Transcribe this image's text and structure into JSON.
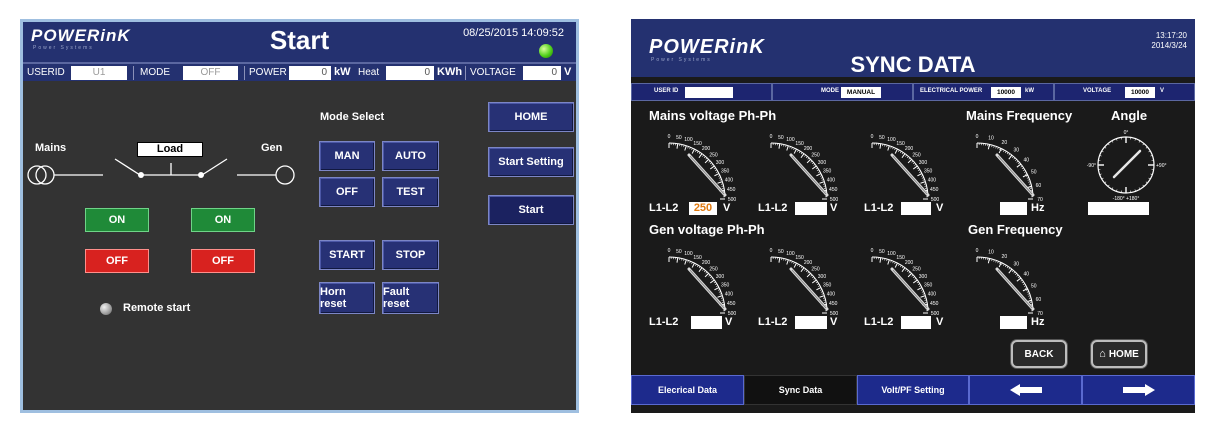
{
  "left": {
    "logo": "POWERinK",
    "logo_sub": "Power Systems",
    "title": "Start",
    "datetime": "08/25/2015 14:09:52",
    "status": {
      "userid_label": "USERID",
      "userid_value": "U1",
      "mode_label": "MODE",
      "mode_value": "OFF",
      "power_label": "POWER",
      "power_value": "0",
      "power_unit": "kW",
      "heat_label": "Heat",
      "heat_value": "0",
      "heat_unit": "KWh",
      "voltage_label": "VOLTAGE",
      "voltage_value": "0",
      "voltage_unit": "V"
    },
    "diagram": {
      "mains": "Mains",
      "load": "Load",
      "gen": "Gen"
    },
    "mains_on": "ON",
    "mains_off": "OFF",
    "gen_on": "ON",
    "gen_off": "OFF",
    "remote_start": "Remote start",
    "mode_select": "Mode Select",
    "btn_man": "MAN",
    "btn_auto": "AUTO",
    "btn_off": "OFF",
    "btn_test": "TEST",
    "btn_start": "START",
    "btn_stop": "STOP",
    "btn_horn_reset": "Horn reset",
    "btn_fault_reset": "Fault reset",
    "nav_home": "HOME",
    "nav_start_setting": "Start Setting",
    "nav_start": "Start",
    "led_color": "#4fcf1a"
  },
  "right": {
    "logo": "POWERinK",
    "logo_sub": "Power Systems",
    "title": "SYNC DATA",
    "time": "13:17:20",
    "date": "2014/3/24",
    "status": {
      "user_label": "USER ID",
      "user_value": "",
      "mode_label": "MODE",
      "mode_value": "MANUAL",
      "power_label": "ELECTRICAL POWER",
      "power_value": "10000",
      "power_unit": "kW",
      "voltage_label": "VOLTAGE",
      "voltage_value": "10000",
      "voltage_unit": "V"
    },
    "mains_voltage_title": "Mains voltage Ph-Ph",
    "mains_freq_title": "Mains Frequency",
    "angle_title": "Angle",
    "gen_voltage_title": "Gen voltage Ph-Ph",
    "gen_freq_title": "Gen Frequency",
    "voltage_scale": [
      "0",
      "50",
      "100",
      "150",
      "200",
      "250",
      "300",
      "350",
      "400",
      "450",
      "500"
    ],
    "freq_scale": [
      "0",
      "10",
      "20",
      "30",
      "40",
      "50",
      "60",
      "70"
    ],
    "angle_labels": {
      "top": "0°",
      "left": "-90°",
      "right": "+90°",
      "bottom": "-180° +180°"
    },
    "phase_label": "L1-L2",
    "volt_unit": "V",
    "hz_unit": "Hz",
    "mains_l1_value": "250",
    "btn_back": "BACK",
    "btn_home": "HOME",
    "tabs": [
      "Elecrical Data",
      "Sync Data",
      "Volt/PF Setting"
    ]
  }
}
